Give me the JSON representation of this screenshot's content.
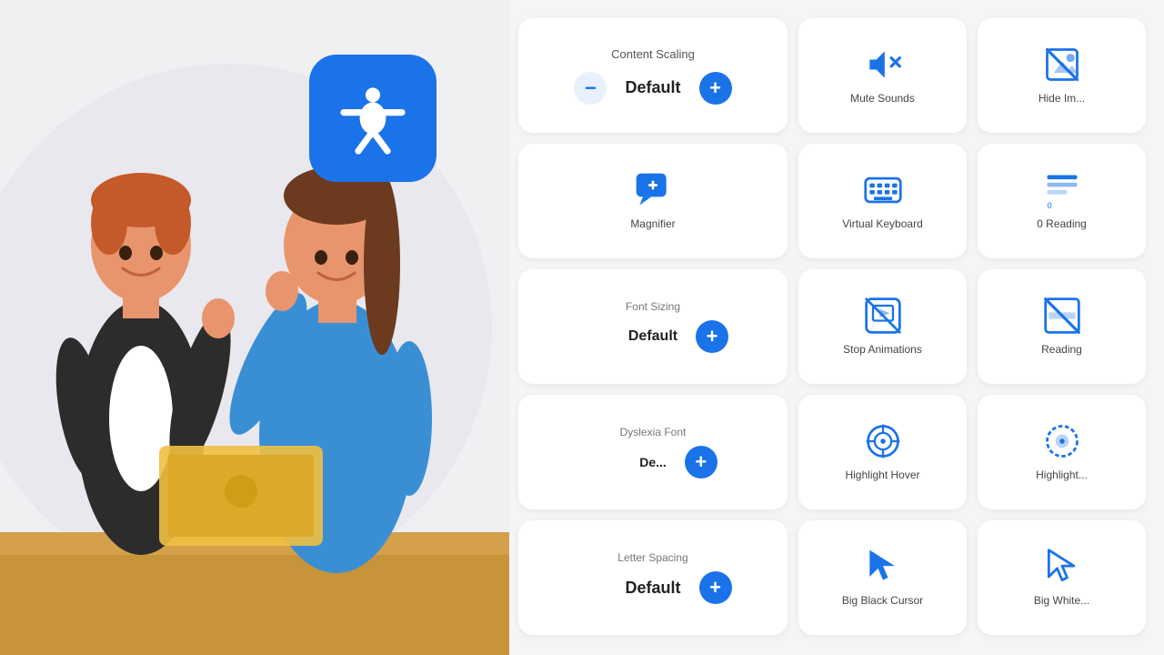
{
  "background": {
    "circle_color": "#e8e8ee"
  },
  "accessibility_icon": {
    "label": "Accessibility Widget",
    "bg_color": "#1a73e8"
  },
  "widgets": {
    "row1": [
      {
        "id": "content-scaling",
        "title": "Content Scaling",
        "value": "Default",
        "type": "scaler",
        "col_span": 1
      },
      {
        "id": "mute-sounds",
        "title": "Mute Sounds",
        "type": "toggle",
        "icon": "mute-icon"
      },
      {
        "id": "hide-images",
        "title": "Hide Im...",
        "type": "toggle",
        "icon": "hide-images-icon"
      }
    ],
    "row2": [
      {
        "id": "magnifier",
        "title": "Magnifier",
        "type": "toggle",
        "icon": "magnifier-icon"
      },
      {
        "id": "virtual-keyboard",
        "title": "Virtual Keyboard",
        "type": "toggle",
        "icon": "keyboard-icon"
      },
      {
        "id": "reading-guide",
        "title": "Reading",
        "type": "toggle",
        "icon": "reading-icon"
      }
    ],
    "row3": [
      {
        "id": "font-sizing",
        "title": "Font Sizing",
        "sub_title": "izing",
        "value": "Default",
        "type": "scaler",
        "partial": true
      },
      {
        "id": "stop-animations",
        "title": "Stop Animations",
        "type": "toggle",
        "icon": "stop-anim-icon"
      },
      {
        "id": "reading-mask",
        "title": "Reading",
        "type": "toggle",
        "icon": "reading-mask-icon"
      }
    ],
    "row4": [
      {
        "id": "dyslexia",
        "title": "Dyslexia",
        "sub_title": "De",
        "value": "Default",
        "type": "scaler_partial",
        "partial": true
      },
      {
        "id": "highlight-hover",
        "title": "Highlight Hover",
        "type": "toggle",
        "icon": "highlight-hover-icon"
      },
      {
        "id": "highlight-focus",
        "title": "Highlight...",
        "type": "toggle",
        "icon": "highlight-focus-icon"
      }
    ],
    "row5": [
      {
        "id": "letter-spacing",
        "title": "Letter Spacing",
        "sub_title": "ter Spacing",
        "value": "Default",
        "type": "scaler_partial",
        "partial": true
      },
      {
        "id": "big-black-cursor",
        "title": "Big Black Cursor",
        "type": "toggle",
        "icon": "black-cursor-icon"
      },
      {
        "id": "big-white-cursor",
        "title": "Big White...",
        "type": "toggle",
        "icon": "white-cursor-icon"
      }
    ]
  },
  "reading_badge": {
    "count": "0",
    "label": "Reading"
  }
}
